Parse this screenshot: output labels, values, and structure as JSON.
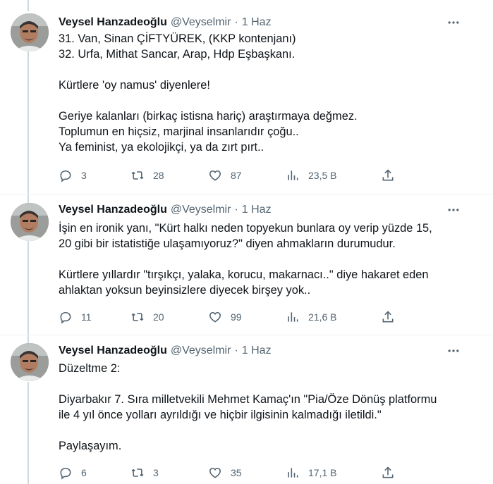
{
  "tweets": [
    {
      "author_name": "Veysel Hanzadeoğlu",
      "handle": "@Veyselmir",
      "dot": "·",
      "time": "1 Haz",
      "lines": [
        "31. Van, Sinan ÇİFTYÜREK, (KKP kontenjanı)",
        "32. Urfa, Mithat Sancar, Arap, Hdp Eşbaşkanı.",
        "",
        "Kürtlere 'oy namus' diyenlere!",
        "",
        "Geriye kalanları (birkaç istisna hariç) araştırmaya değmez.",
        "Toplumun en hiçsiz, marjinal insanlarıdır çoğu..",
        "Ya feminist, ya ekolojikçi, ya da zırt pırt.."
      ],
      "replies": "3",
      "retweets": "28",
      "likes": "87",
      "views": "23,5 B"
    },
    {
      "author_name": "Veysel Hanzadeoğlu",
      "handle": "@Veyselmir",
      "dot": "·",
      "time": "1 Haz",
      "lines": [
        "İşin en ironik yanı, \"Kürt halkı neden topyekun bunlara oy verip yüzde 15,",
        "20 gibi bir istatistiğe ulaşamıyoruz?\" diyen ahmakların durumudur.",
        "",
        "Kürtlere  yıllardır \"tırşıkçı, yalaka, korucu, makarnacı..\" diye hakaret eden",
        "ahlaktan yoksun beyinsizlere diyecek birşey yok.."
      ],
      "replies": "11",
      "retweets": "20",
      "likes": "99",
      "views": "21,6 B"
    },
    {
      "author_name": "Veysel Hanzadeoğlu",
      "handle": "@Veyselmir",
      "dot": "·",
      "time": "1 Haz",
      "lines": [
        "Düzeltme 2:",
        "",
        "Diyarbakır 7. Sıra milletvekili Mehmet Kamaç'ın \"Pia/Öze Dönüş platformu",
        "ile 4 yıl önce yolları ayrıldığı ve hiçbir ilgisinin kalmadığı iletildi.\"",
        "",
        "Paylaşayım."
      ],
      "replies": "6",
      "retweets": "3",
      "likes": "35",
      "views": "17,1 B"
    }
  ],
  "icons": {
    "reply": "reply-icon",
    "retweet": "retweet-icon",
    "like": "heart-icon",
    "views": "views-icon",
    "share": "share-icon",
    "more": "more-icon"
  },
  "colors": {
    "text": "#0f1419",
    "secondary": "#536471",
    "thread_line": "#cfd9de",
    "divider": "#eff3f4"
  }
}
